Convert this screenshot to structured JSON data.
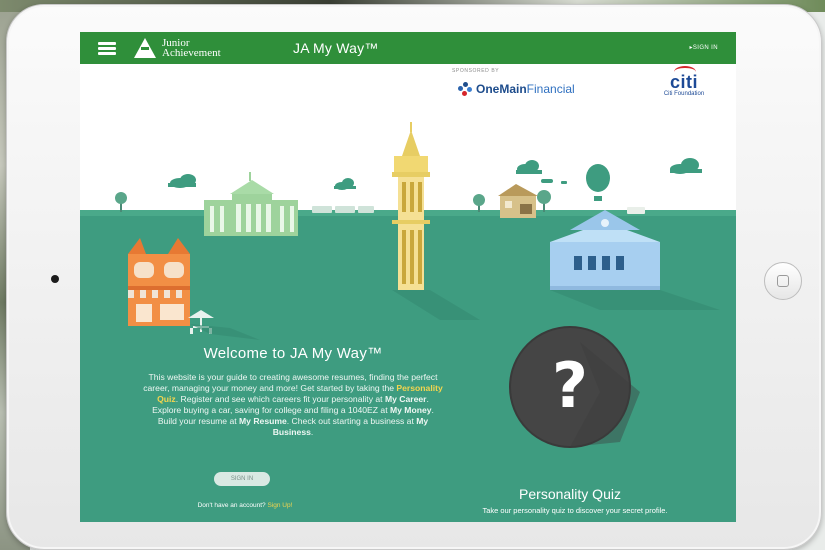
{
  "header": {
    "app_title": "JA My Way™",
    "org_name_line1": "Junior",
    "org_name_line2": "Achievement",
    "sign_in_label": "▸SIGN IN"
  },
  "sponsors": {
    "label": "SPONSORED BY",
    "sponsor1_bold": "OneMain",
    "sponsor1_regular": "Financial",
    "sponsor2_mark": "citi",
    "sponsor2_sub": "Citi Foundation"
  },
  "welcome": {
    "title": "Welcome to JA My Way™",
    "p1": "This website is your guide to creating awesome resumes, finding the perfect career, managing your money and more! Get started by taking the ",
    "link_quiz": "Personality Quiz",
    "p2": ". Register and see which careers fit your personality at ",
    "link_career": "My Career",
    "p3": ". Explore buying a car, saving for college and filing a 1040EZ at ",
    "link_money": "My Money",
    "p4": ". Build your resume at ",
    "link_resume": "My Resume",
    "p5": ". Check out starting a business at ",
    "link_business": "My Business",
    "p6": ".",
    "sign_in_button": "SIGN IN",
    "no_account_text": "Don't have an account? ",
    "sign_up_link": "Sign Up!"
  },
  "quiz": {
    "symbol": "?",
    "title": "Personality Quiz",
    "subtitle": "Take our personality quiz to discover your secret profile."
  },
  "colors": {
    "header_green": "#2f8f3a",
    "teal_ground": "#3d9c7f",
    "accent_yellow": "#f3d54e"
  }
}
